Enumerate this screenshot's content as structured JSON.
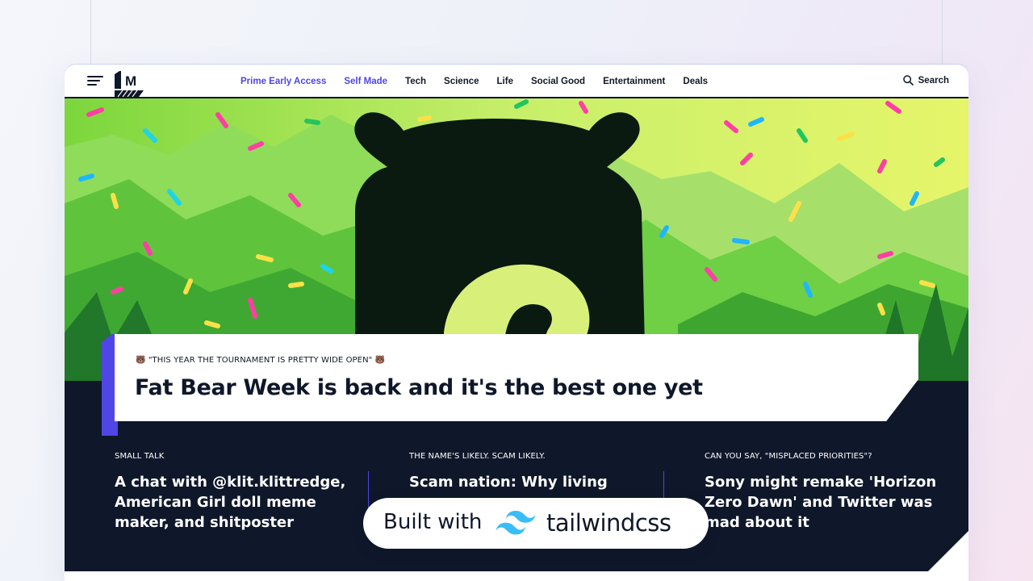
{
  "nav": {
    "links": [
      "Prime Early Access",
      "Self Made",
      "Tech",
      "Science",
      "Life",
      "Social Good",
      "Entertainment",
      "Deals"
    ],
    "search_label": "Search",
    "accent_color": "#4f46e5"
  },
  "logo": {
    "text": "M",
    "mark": "1"
  },
  "hero": {
    "image": "fat-bear-week-illustration",
    "kicker": "🐻 \"THIS YEAR THE TOURNAMENT IS PRETTY WIDE OPEN\" 🐻",
    "title": "Fat Bear Week is back and it's the best one yet"
  },
  "stories": [
    {
      "tag": "SMALL TALK",
      "title": "A chat with @klit.klittredge, American Girl doll meme maker, and shitposter"
    },
    {
      "tag": "THE NAME'S LIKELY. SCAM LIKELY.",
      "title": "Scam nation: Why living"
    },
    {
      "tag": "CAN YOU SAY, \"MISPLACED PRIORITIES\"?",
      "title": "Sony might remake 'Horizon Zero Dawn' and Twitter was mad about it"
    }
  ],
  "badge": {
    "prefix": "Built with",
    "brand": "tailwindcss"
  },
  "colors": {
    "dark_bg": "#0f172a",
    "accent": "#4f46e5",
    "hero_green": "#6ed64a",
    "bear": "#0a1a10"
  }
}
